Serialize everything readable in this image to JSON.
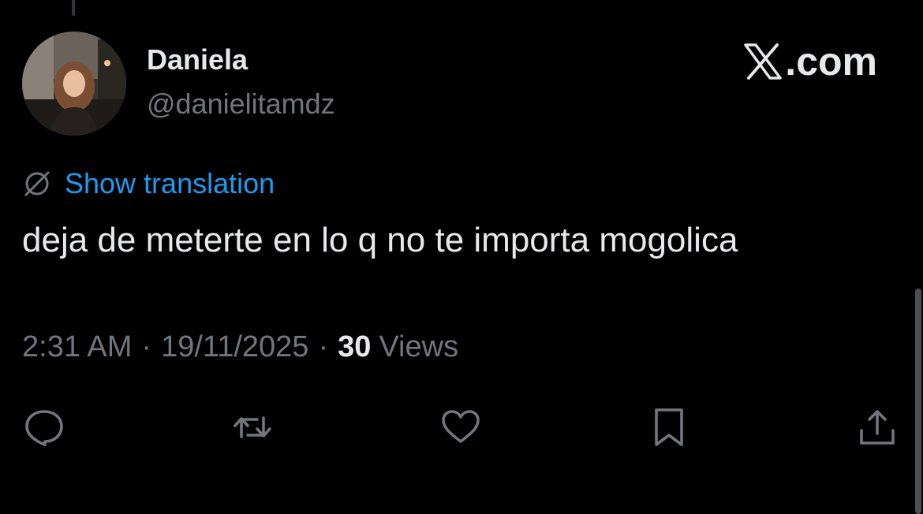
{
  "author": {
    "name": "Daniela",
    "handle": "@danielitamdz",
    "avatar_icon": "profile-photo"
  },
  "brand": {
    "logo_icon": "x-logo-icon",
    "suffix": ".com"
  },
  "translation": {
    "icon": "globe-translate-icon",
    "label": "Show translation"
  },
  "tweet": {
    "text": "deja de meterte en lo q no te importa mogolica"
  },
  "meta": {
    "time": "2:31 AM",
    "separator": "·",
    "date": "19/11/2025",
    "views_count": "30",
    "views_label": "Views"
  },
  "actions": [
    {
      "name": "reply",
      "icon": "reply-icon"
    },
    {
      "name": "retweet",
      "icon": "retweet-icon"
    },
    {
      "name": "like",
      "icon": "heart-icon"
    },
    {
      "name": "bookmark",
      "icon": "bookmark-icon"
    },
    {
      "name": "share",
      "icon": "share-icon"
    }
  ],
  "colors": {
    "background": "#000000",
    "primary_text": "#e7e9ea",
    "secondary_text": "#71767b",
    "link": "#1d9bf0"
  }
}
